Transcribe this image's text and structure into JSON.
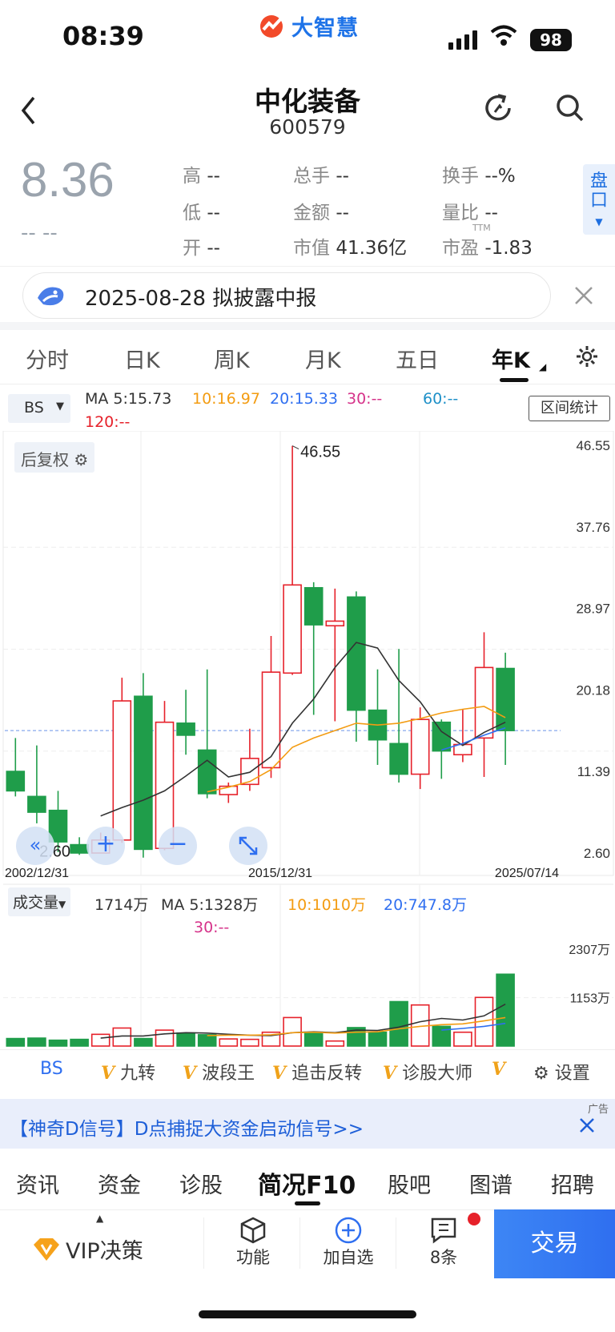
{
  "status": {
    "time": "08:39",
    "brand": "大智慧",
    "battery": "98"
  },
  "header": {
    "name": "中化装备",
    "code": "600579"
  },
  "quote": {
    "price": "8.36",
    "change": "--  --",
    "stats": [
      {
        "label": "高",
        "value": "--"
      },
      {
        "label": "总手",
        "value": "--"
      },
      {
        "label": "换手",
        "value": "--%"
      },
      {
        "label": "低",
        "value": "--"
      },
      {
        "label": "金额",
        "value": "--"
      },
      {
        "label": "量比",
        "value": "--"
      },
      {
        "label": "开",
        "value": "--"
      },
      {
        "label": "市值",
        "value": "41.36亿"
      },
      {
        "label": "市盈",
        "value": "-1.83"
      }
    ],
    "ttm": "TTM",
    "pankou": "盘口"
  },
  "banner": {
    "text": "2025-08-28 拟披露中报"
  },
  "tabs": [
    "分时",
    "日K",
    "周K",
    "月K",
    "五日",
    "年K"
  ],
  "active_tab": "年K",
  "chart_controls": {
    "bs": "BS",
    "range_stat": "区间统计",
    "fq": "后复权",
    "vol_label": "成交量"
  },
  "ma": {
    "ma5": "MA 5:15.73",
    "ma10": "10:16.97",
    "ma20": "20:15.33",
    "ma30": "30:--",
    "ma60": "60:--",
    "ma120": "120:--"
  },
  "vol_ma": {
    "vol": "1714万",
    "ma5": "MA 5:1328万",
    "ma10": "10:1010万",
    "ma20": "20:747.8万",
    "ma30": "30:--"
  },
  "colors": {
    "up": "#e6212a",
    "down": "#1f9d4a",
    "ma5": "#333333",
    "ma10": "#f39c12",
    "ma20": "#2f6ff0",
    "ma30": "#d6338a",
    "ma60": "#1e90c8",
    "ma120": "#e6212a"
  },
  "chart_data": {
    "type": "candlestick",
    "price_axis_labels": [
      "46.55",
      "37.76",
      "28.97",
      "20.18",
      "11.39",
      "2.60"
    ],
    "ylim": [
      2.6,
      46.55
    ],
    "date_labels": [
      "2002/12/31",
      "2015/12/31",
      "2025/07/14"
    ],
    "max_label": "46.55",
    "min_label": "2.60",
    "candles": [
      {
        "o": 11.4,
        "c": 9.3,
        "h": 15.0,
        "l": 8.7
      },
      {
        "o": 8.7,
        "c": 7.0,
        "h": 14.2,
        "l": 5.8
      },
      {
        "o": 7.2,
        "c": 3.8,
        "h": 9.3,
        "l": 2.7
      },
      {
        "o": 3.5,
        "c": 2.6,
        "h": 4.3,
        "l": 2.4
      },
      {
        "o": 2.6,
        "c": 4.0,
        "h": 4.8,
        "l": 2.6
      },
      {
        "o": 4.0,
        "c": 19.0,
        "h": 21.5,
        "l": 3.7
      },
      {
        "o": 19.5,
        "c": 3.0,
        "h": 22.0,
        "l": 2.1
      },
      {
        "o": 3.1,
        "c": 16.7,
        "h": 19.0,
        "l": 2.9
      },
      {
        "o": 16.6,
        "c": 15.3,
        "h": 20.2,
        "l": 13.2
      },
      {
        "o": 13.7,
        "c": 9.0,
        "h": 22.4,
        "l": 8.5
      },
      {
        "o": 8.9,
        "c": 9.8,
        "h": 10.2,
        "l": 8.0
      },
      {
        "o": 10.0,
        "c": 12.8,
        "h": 16.0,
        "l": 9.3
      },
      {
        "o": 11.8,
        "c": 22.1,
        "h": 26.0,
        "l": 10.7
      },
      {
        "o": 22.0,
        "c": 31.5,
        "h": 46.5,
        "l": 21.8
      },
      {
        "o": 31.2,
        "c": 27.2,
        "h": 31.8,
        "l": 17.5
      },
      {
        "o": 27.1,
        "c": 27.6,
        "h": 31.1,
        "l": 16.8
      },
      {
        "o": 30.2,
        "c": 18.0,
        "h": 30.8,
        "l": 14.6
      },
      {
        "o": 18.0,
        "c": 14.8,
        "h": 22.4,
        "l": 12.1
      },
      {
        "o": 14.4,
        "c": 11.1,
        "h": 24.6,
        "l": 10.2
      },
      {
        "o": 11.1,
        "c": 17.0,
        "h": 18.3,
        "l": 9.5
      },
      {
        "o": 16.7,
        "c": 13.6,
        "h": 17.0,
        "l": 10.6
      },
      {
        "o": 13.2,
        "c": 14.3,
        "h": 18.1,
        "l": 12.4
      },
      {
        "o": 15.0,
        "c": 22.6,
        "h": 26.4,
        "l": 10.8
      },
      {
        "o": 22.5,
        "c": 15.8,
        "h": 24.2,
        "l": 12.1
      }
    ],
    "ma5": [
      null,
      null,
      null,
      null,
      6.6,
      7.5,
      8.3,
      9.3,
      10.9,
      12.6,
      10.8,
      11.3,
      13.0,
      16.6,
      19.2,
      22.6,
      25.3,
      24.7,
      21.2,
      18.9,
      15.7,
      14.2,
      15.6,
      16.7
    ],
    "ma10": [
      null,
      null,
      null,
      null,
      null,
      null,
      null,
      null,
      null,
      9.2,
      9.7,
      10.3,
      11.6,
      14.0,
      15.0,
      15.8,
      16.6,
      16.4,
      16.6,
      17.1,
      17.7,
      18.1,
      18.4,
      17.2
    ],
    "ma20": [
      null,
      null,
      null,
      null,
      null,
      null,
      null,
      null,
      null,
      null,
      null,
      null,
      null,
      null,
      null,
      null,
      null,
      null,
      null,
      null,
      13.7,
      14.4,
      15.3,
      16.1
    ],
    "volume_axis_labels": [
      "2307万",
      "1153万"
    ],
    "volume": [
      180,
      190,
      140,
      160,
      280,
      430,
      180,
      380,
      310,
      270,
      170,
      160,
      330,
      680,
      330,
      120,
      440,
      330,
      1060,
      980,
      470,
      330,
      1160,
      1714
    ],
    "vol_ma5": [
      null,
      null,
      null,
      null,
      190,
      240,
      240,
      290,
      320,
      310,
      280,
      260,
      250,
      320,
      340,
      320,
      380,
      370,
      450,
      580,
      660,
      620,
      720,
      1000
    ],
    "vol_ma10": [
      null,
      null,
      null,
      null,
      null,
      null,
      null,
      null,
      null,
      250,
      260,
      260,
      270,
      320,
      330,
      310,
      330,
      340,
      410,
      470,
      510,
      530,
      600,
      680
    ],
    "vol_ma20": [
      null,
      null,
      null,
      null,
      null,
      null,
      null,
      null,
      null,
      null,
      null,
      null,
      null,
      null,
      null,
      null,
      null,
      null,
      null,
      null,
      380,
      420,
      470,
      540
    ]
  },
  "tools": [
    "BS",
    "九转",
    "波段王",
    "追击反转",
    "诊股大师",
    "设置"
  ],
  "ad": {
    "text": "【神奇D信号】D点捕捉大资金启动信号>>",
    "tag": "广告"
  },
  "f10_tabs": [
    "资讯",
    "资金",
    "诊股",
    "简况F10",
    "股吧",
    "图谱",
    "招聘"
  ],
  "active_f10": "简况F10",
  "bottom": {
    "vip": "VIP决策",
    "func": "功能",
    "add": "加自选",
    "msg": "8条",
    "trade": "交易"
  }
}
